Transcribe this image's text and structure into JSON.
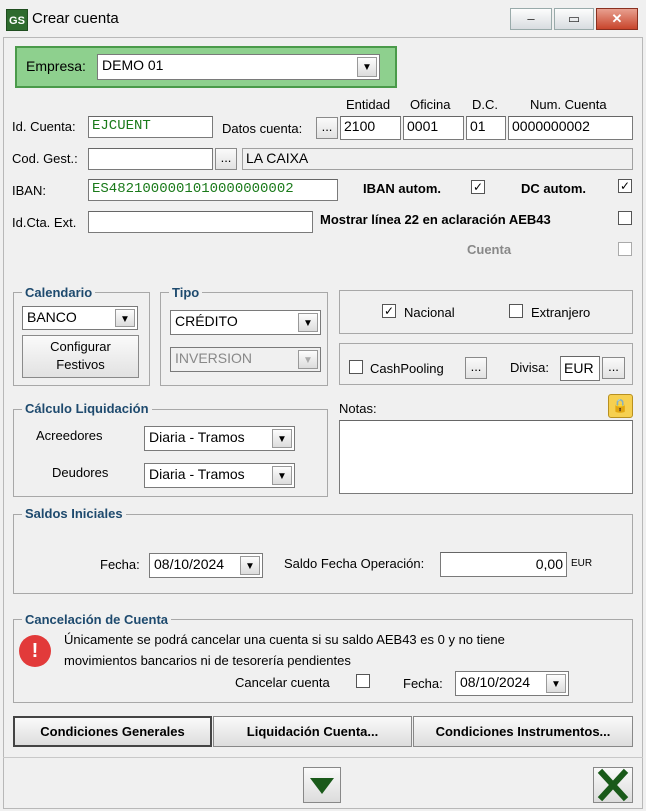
{
  "window": {
    "app_icon": "GS",
    "title": "Crear cuenta",
    "minimize": "–",
    "maximize": "▭",
    "close": "✕"
  },
  "empresa": {
    "label": "Empresa:",
    "value": "DEMO 01"
  },
  "headers": {
    "entidad": "Entidad",
    "oficina": "Oficina",
    "dc": "D.C.",
    "num_cuenta": "Num. Cuenta"
  },
  "id_cuenta": {
    "label": "Id. Cuenta:",
    "value": "EJCUENT"
  },
  "datos_cuenta": {
    "label": "Datos cuenta:",
    "btn": "...",
    "entidad": "2100",
    "oficina": "0001",
    "dc": "01",
    "num_cuenta": "0000000002"
  },
  "cod_gest": {
    "label": "Cod. Gest.:",
    "value": "",
    "btn": "...",
    "bank_name": "LA CAIXA"
  },
  "iban": {
    "label": "IBAN:",
    "value": "ES4821000001010000000002"
  },
  "iban_autom": {
    "label": "IBAN autom.",
    "checked": "✓"
  },
  "dc_autom": {
    "label": "DC autom.",
    "checked": "✓"
  },
  "id_cta_ext": {
    "label": "Id.Cta. Ext.",
    "value": ""
  },
  "mostrar_linea": {
    "label": "Mostrar línea 22 en aclaración AEB43"
  },
  "cuenta_check": {
    "label": "Cuenta"
  },
  "calendario": {
    "title": "Calendario",
    "value": "BANCO",
    "btn_line1": "Configurar",
    "btn_line2": "Festivos"
  },
  "tipo": {
    "title": "Tipo",
    "value": "CRÉDITO",
    "subvalue": "INVERSION"
  },
  "nacional": {
    "label": "Nacional",
    "checked": "✓"
  },
  "extranjero": {
    "label": "Extranjero"
  },
  "cashpooling": {
    "label": "CashPooling",
    "btn": "..."
  },
  "divisa": {
    "label": "Divisa:",
    "value": "EUR",
    "btn": "..."
  },
  "calculo": {
    "title": "Cálculo Liquidación",
    "acreedores_label": "Acreedores",
    "acreedores": "Diaria - Tramos",
    "deudores_label": "Deudores",
    "deudores": "Diaria - Tramos"
  },
  "notas": {
    "label": "Notas:",
    "value": ""
  },
  "saldos": {
    "title": "Saldos Iniciales",
    "fecha_label": "Fecha:",
    "fecha": "08/10/2024",
    "saldo_label": "Saldo Fecha Operación:",
    "saldo": "0,00",
    "currency": "EUR"
  },
  "cancelacion": {
    "title": "Cancelación de Cuenta",
    "msg_line1": "Únicamente se podrá cancelar una cuenta si su saldo AEB43 es 0 y no tiene",
    "msg_line2": "movimientos bancarios ni de tesorería pendientes",
    "cancelar_label": "Cancelar cuenta",
    "fecha_label": "Fecha:",
    "fecha": "08/10/2024"
  },
  "buttons": {
    "condiciones_generales": "Condiciones Generales",
    "liquidacion": "Liquidación Cuenta...",
    "condiciones_instrumentos": "Condiciones Instrumentos..."
  },
  "colors": {
    "company_bg": "#8ed08e",
    "value_green": "#1a7a1a",
    "group_title": "#1e4a6e",
    "accept": "#1a5a1a"
  }
}
